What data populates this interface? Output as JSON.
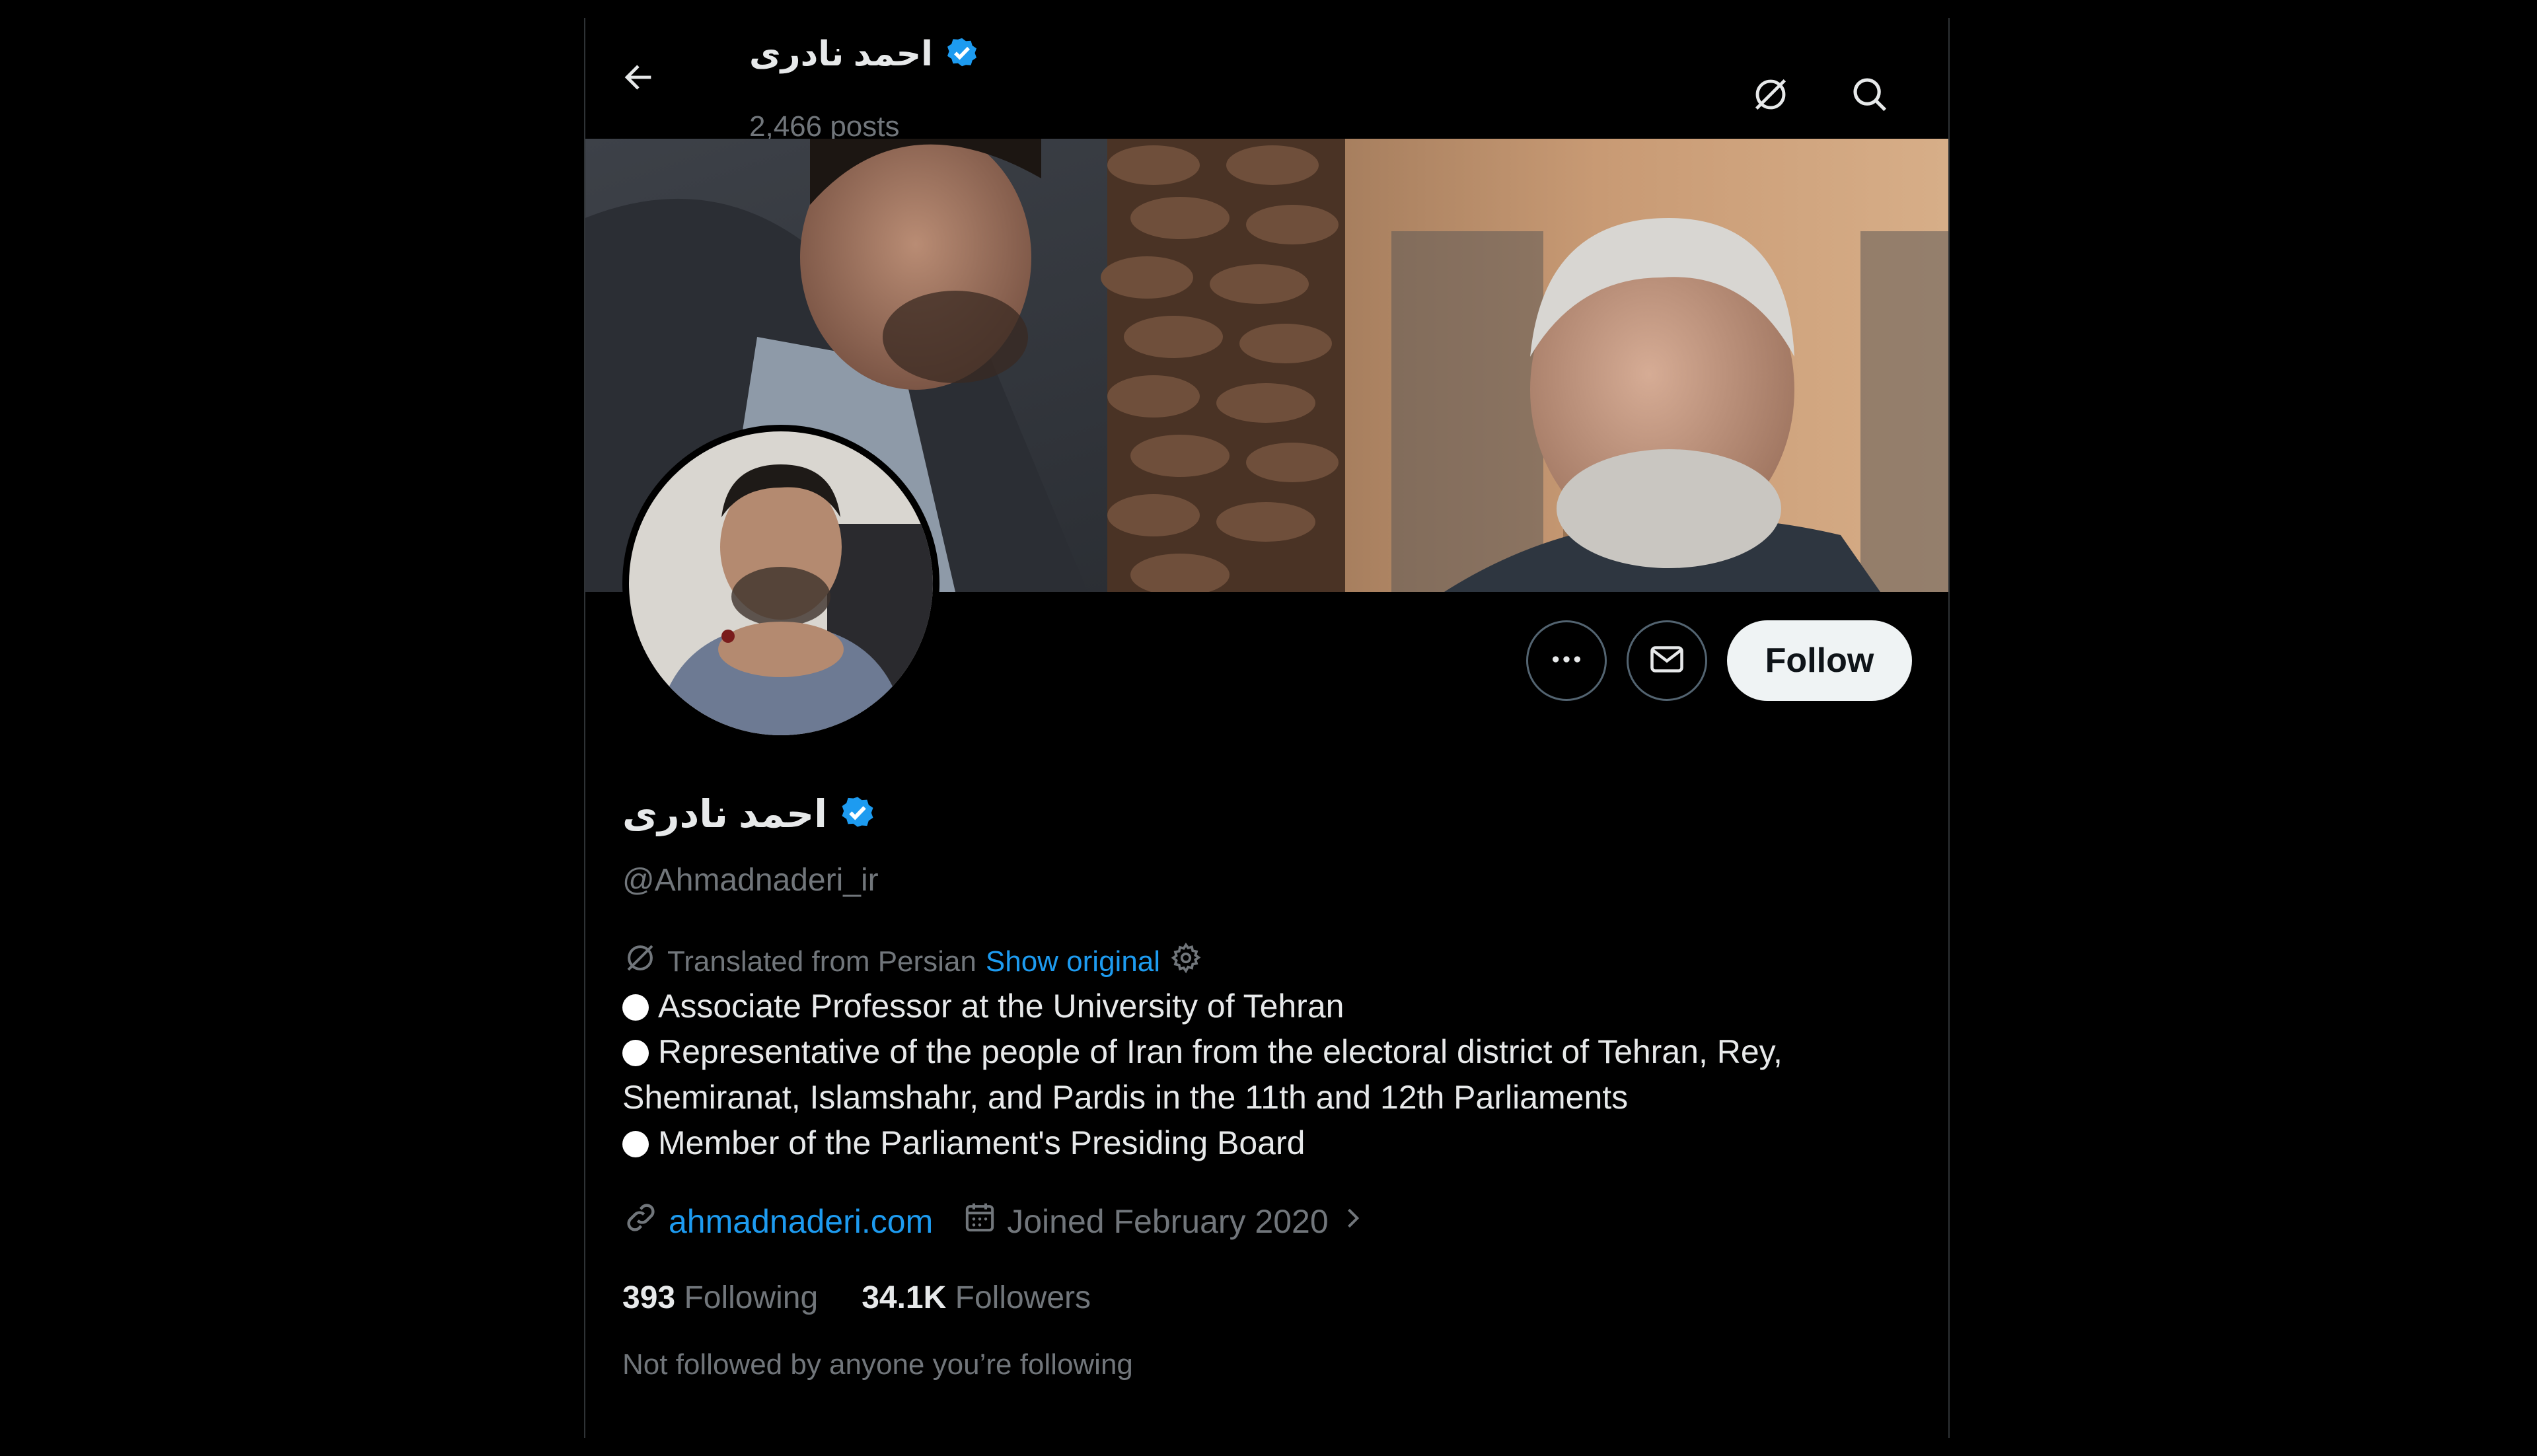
{
  "header": {
    "name": "احمد نادری",
    "posts_count": "2,466 posts"
  },
  "profile": {
    "display_name": "احمد نادری",
    "handle": "@Ahmadnaderi_ir",
    "follow_label": "Follow",
    "translated_from": "Translated from Persian",
    "show_original": "Show original",
    "bio": [
      "Associate Professor at the University of Tehran",
      "Representative of the people of Iran from the electoral district of Tehran, Rey, Shemiranat, Islamshahr, and Pardis in the 11th and 12th Parliaments",
      "Member of the Parliament's Presiding Board"
    ],
    "website": "ahmadnaderi.com",
    "joined": "Joined February 2020",
    "following_count": "393",
    "following_label": "Following",
    "followers_count": "34.1K",
    "followers_label": "Followers",
    "not_followed_text": "Not followed by anyone you’re following"
  },
  "icons": {
    "back": "arrow-left-icon",
    "translate": "translate-icon",
    "search": "search-icon",
    "verified": "verified-badge-icon",
    "more": "more-horizontal-icon",
    "mail": "mail-icon",
    "link": "link-icon",
    "calendar": "calendar-icon",
    "chevron": "chevron-right-icon",
    "settings": "gear-icon"
  },
  "colors": {
    "background": "#000000",
    "accent": "#1d9bf0",
    "text_primary": "#e7e9ea",
    "text_secondary": "#71767b"
  }
}
